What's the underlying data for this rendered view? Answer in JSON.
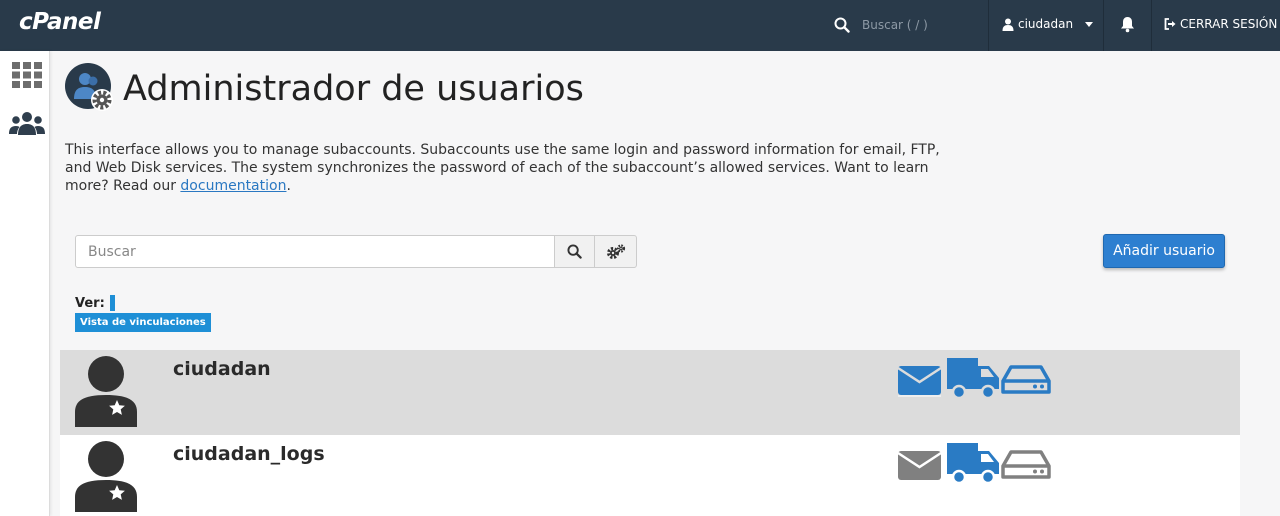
{
  "app": {
    "logo": "cPanel"
  },
  "topbar": {
    "search_placeholder": "Buscar ( / )",
    "username": "ciudadan",
    "logout_label": "CERRAR SESIÓN"
  },
  "page": {
    "title": "Administrador de usuarios",
    "description": "This interface allows you to manage subaccounts. Subaccounts use the same login and password information for email, FTP, and Web Disk services. The system synchronizes the password of each of the subaccount’s allowed services. Want to learn more? Read our ",
    "doc_link": "documentation",
    "desc_end": "."
  },
  "search": {
    "placeholder": "Buscar"
  },
  "add_user_label": "Añadir usuario",
  "view": {
    "label": "Ver:",
    "badge": "Vista de vinculaciones"
  },
  "users": [
    {
      "name": "ciudadan",
      "email_enabled": true,
      "ftp_enabled": true,
      "webdisk_enabled": true
    },
    {
      "name": "ciudadan_logs",
      "email_enabled": false,
      "ftp_enabled": true,
      "webdisk_enabled": false
    }
  ],
  "colors": {
    "navbar": "#293a4a",
    "accent": "#2d7fd0",
    "service_enabled": "#2a7bc4",
    "service_disabled": "#808080"
  },
  "icons": [
    "search-icon",
    "user-icon",
    "bell-icon",
    "logout-icon",
    "apps-grid-icon",
    "users-group-icon",
    "user-manager-icon",
    "gear-icon",
    "gears-icon",
    "avatar-icon",
    "star-icon",
    "email-icon",
    "ftp-truck-icon",
    "webdisk-icon"
  ]
}
